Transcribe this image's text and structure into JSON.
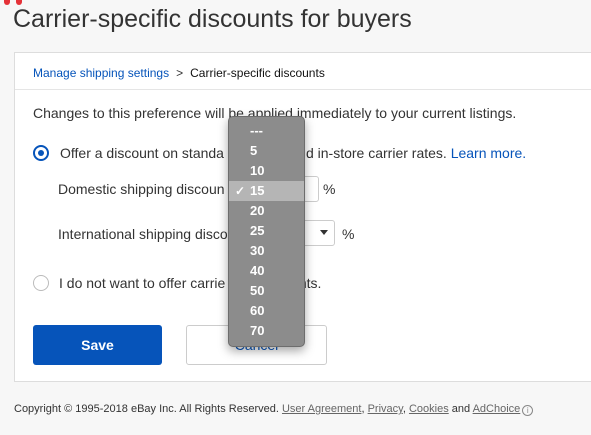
{
  "colors": {
    "accent": "#0654ba",
    "logo": [
      "#e53238",
      "#0064d2",
      "#f5af02",
      "#86b817"
    ]
  },
  "page": {
    "title": "Carrier-specific discounts for buyers"
  },
  "breadcrumb": {
    "parent": "Manage shipping settings",
    "separator": ">",
    "current": "Carrier-specific discounts"
  },
  "notice": "Changes to this preference will be applied immediately to your current listings.",
  "option_offer": {
    "selected": true,
    "text_before": "Offer a discount on standa",
    "text_after": "d in-store carrier rates.",
    "learn_more": "Learn more."
  },
  "domestic": {
    "label": "Domestic shipping discoun",
    "unit": "%"
  },
  "international": {
    "label": "International shipping disco",
    "unit": "%"
  },
  "option_none": {
    "selected": false,
    "text_before": "I do not want to offer carrie",
    "text_after": "scounts."
  },
  "buttons": {
    "save": "Save",
    "cancel": "Cancel"
  },
  "dropdown": {
    "selected": "15",
    "check_glyph": "✓",
    "options": [
      "---",
      "5",
      "10",
      "15",
      "20",
      "25",
      "30",
      "40",
      "50",
      "60",
      "70"
    ]
  },
  "footer": {
    "copyright": "Copyright © 1995-2018 eBay Inc. All Rights Reserved.",
    "links": [
      "User Agreement",
      "Privacy",
      "Cookies",
      "AdChoice"
    ],
    "and": "and",
    "adchoice_icon": "i"
  }
}
